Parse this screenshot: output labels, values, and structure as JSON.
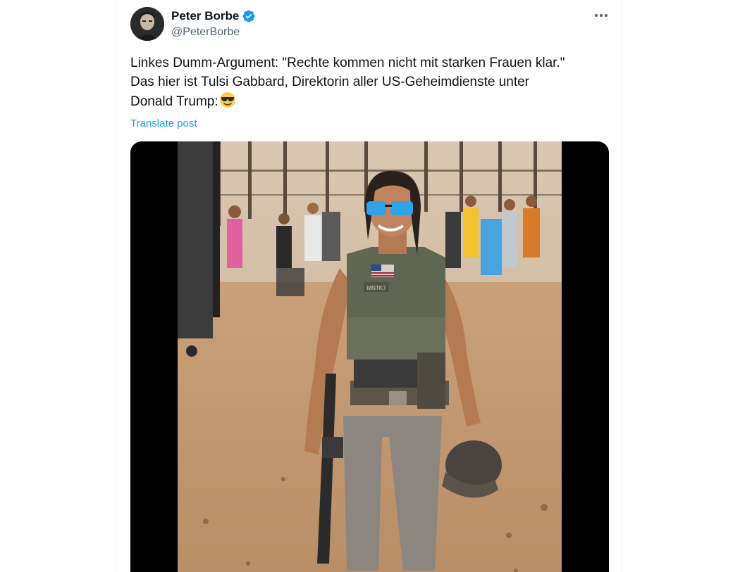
{
  "author": {
    "display_name": "Peter Borbe",
    "handle": "@PeterBorbe",
    "verified": true,
    "verified_color": "#1d9bf0",
    "avatar_icon": "profile-photo"
  },
  "post": {
    "lines": [
      "Linkes Dumm-Argument: \"Rechte kommen nicht mit starken Frauen klar.\"",
      "Das hier ist Tulsi Gabbard, Direktorin aller US-Geheimdienste unter",
      "Donald Trump:"
    ],
    "emoji": "smiling-face-with-sunglasses",
    "translate_label": "Translate post",
    "link_color": "#1d9bf0"
  },
  "media": {
    "patch_text": "MNTK7"
  },
  "menu": {
    "icon": "more-horizontal-icon"
  }
}
